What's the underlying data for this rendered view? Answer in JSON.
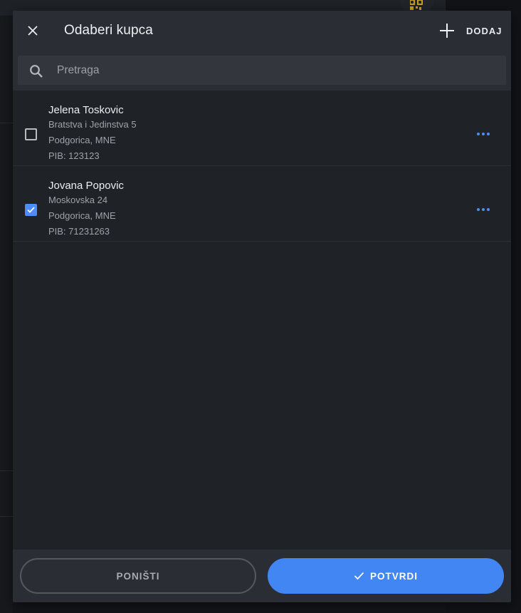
{
  "dialog": {
    "title": "Odaberi kupca",
    "add_label": "DODAJ"
  },
  "search": {
    "placeholder": "Pretraga",
    "value": ""
  },
  "customers": [
    {
      "name": "Jelena Toskovic",
      "address": "Bratstva i Jedinstva 5",
      "city": "Podgorica, MNE",
      "pib": "PIB: 123123",
      "selected": false
    },
    {
      "name": "Jovana Popovic",
      "address": "Moskovska 24",
      "city": "Podgorica, MNE",
      "pib": "PIB: 71231263",
      "selected": true
    }
  ],
  "footer": {
    "cancel_label": "PONIŠTI",
    "confirm_label": "POTVRDI"
  },
  "icons": {
    "close": "close-icon",
    "add": "plus-icon",
    "search": "search-icon",
    "more": "more-horizontal-icon",
    "confirm": "check-icon",
    "background": "qr-code-icon"
  },
  "colors": {
    "accent": "#4286f4",
    "header_bg": "#2a2e34",
    "dialog_bg": "#1f2227",
    "qr_icon": "#c9a227"
  }
}
